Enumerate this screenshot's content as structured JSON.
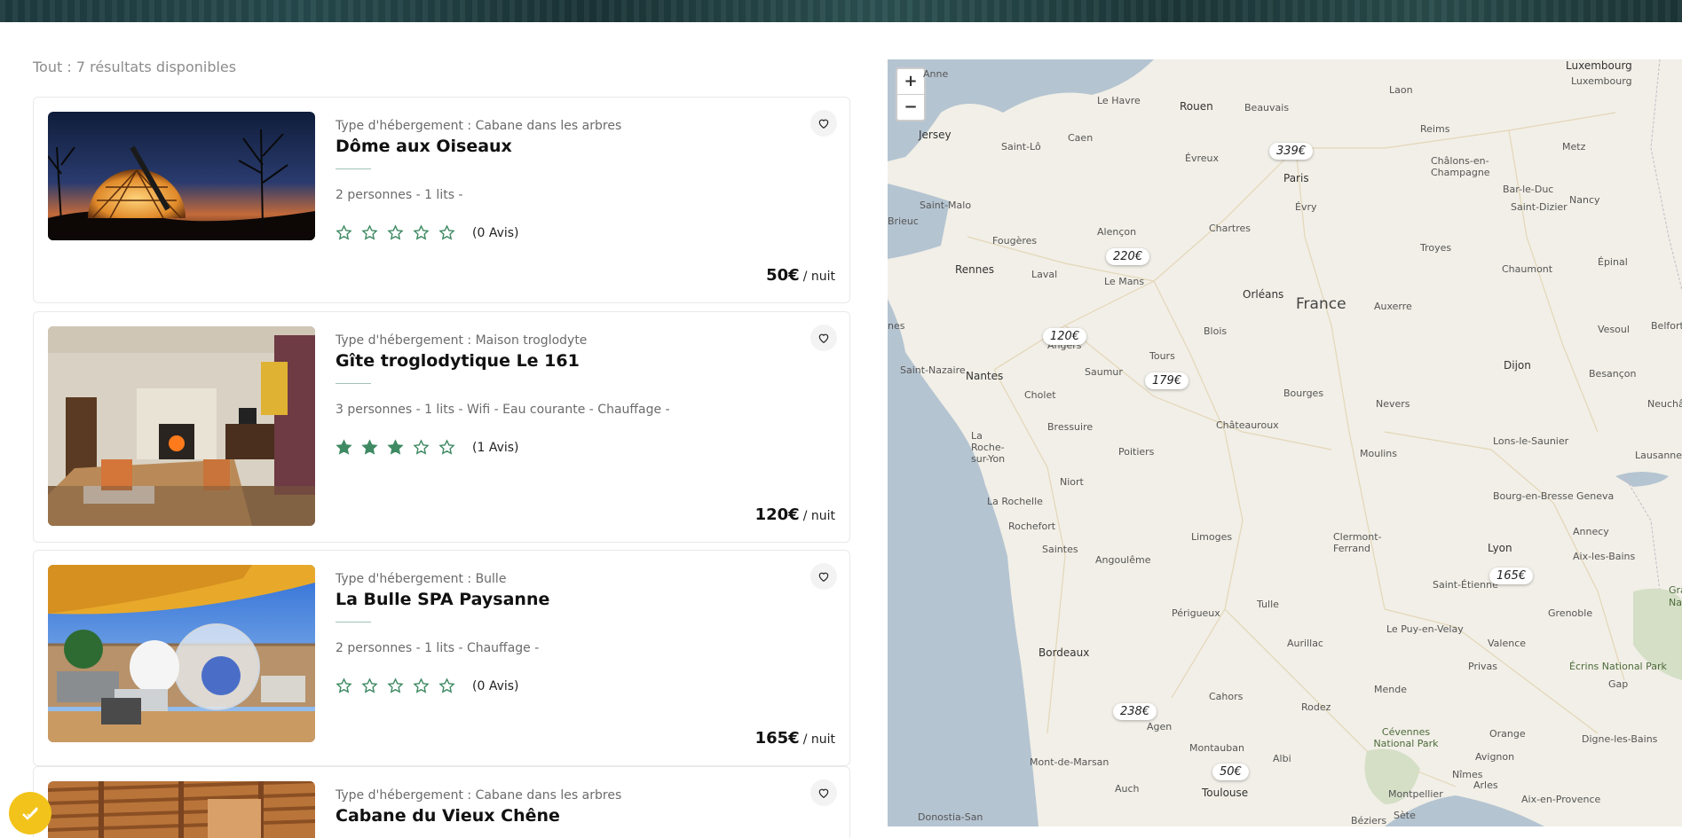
{
  "results": {
    "label": "Tout : 7 résultats disponibles"
  },
  "listings": [
    {
      "type": "Type d'hébergement : Cabane dans les arbres",
      "title": "Dôme aux Oiseaux",
      "features": "2 personnes - 1 lits -",
      "rating": 0,
      "reviews": "(0 Avis)",
      "price": "50€",
      "per_night": "/ nuit"
    },
    {
      "type": "Type d'hébergement : Maison troglodyte",
      "title": "Gîte troglodytique Le 161",
      "features": "3 personnes - 1 lits - Wifi - Eau courante - Chauffage -",
      "rating": 3,
      "reviews": "(1 Avis)",
      "price": "120€",
      "per_night": "/ nuit"
    },
    {
      "type": "Type d'hébergement : Bulle",
      "title": "La Bulle SPA Paysanne",
      "features": "2 personnes - 1 lits - Chauffage -",
      "rating": 0,
      "reviews": "(0 Avis)",
      "price": "165€",
      "per_night": "/ nuit"
    },
    {
      "type": "Type d'hébergement : Cabane dans les arbres",
      "title": "Cabane du Vieux Chêne"
    }
  ],
  "map": {
    "zoom_in": "+",
    "zoom_out": "−",
    "price_pins": [
      "339€",
      "220€",
      "120€",
      "179€",
      "165€",
      "238€",
      "50€"
    ],
    "labels": {
      "luxembourg": "Luxembourg",
      "luxembourg2": "Luxembourg",
      "anne": "Anne",
      "le_havre": "Le Havre",
      "rouen": "Rouen",
      "beauvais": "Beauvais",
      "laon": "Laon",
      "jersey": "Jersey",
      "saint_lo": "Saint-Lô",
      "caen": "Caen",
      "evreux": "Évreux",
      "reims": "Reims",
      "metz": "Metz",
      "paris": "Paris",
      "chalons": "Châlons-en-Champagne",
      "evry": "Évry",
      "saint_malo": "Saint-Malo",
      "brieuc": "Brieuc",
      "fougeres": "Fougères",
      "alencon": "Alençon",
      "chartres": "Chartres",
      "bar_le_duc": "Bar-le-Duc",
      "nancy": "Nancy",
      "saint_dizier": "Saint-Dizier",
      "troyes": "Troyes",
      "epinal": "Épinal",
      "rennes": "Rennes",
      "laval": "Laval",
      "le_mans": "Le Mans",
      "orleans": "Orléans",
      "chaumont": "Chaumont",
      "france": "France",
      "auxerre": "Auxerre",
      "vesoul": "Vesoul",
      "belfort": "Belfort",
      "blois": "Blois",
      "nes": "nes",
      "angers": "Angers",
      "tours": "Tours",
      "saint_nazaire": "Saint-Nazaire",
      "nantes": "Nantes",
      "saumur": "Saumur",
      "dijon": "Dijon",
      "besancon": "Besançon",
      "cholet": "Cholet",
      "bourges": "Bourges",
      "nevers": "Nevers",
      "neuchat": "Neuchât",
      "bressuire": "Bressuire",
      "chateauroux": "Châteauroux",
      "la_roche": "La Roche-sur-Yon",
      "lons": "Lons-le-Saunier",
      "poitiers": "Poitiers",
      "moulins": "Moulins",
      "lausanne": "Lausanne",
      "niort": "Niort",
      "bourg": "Bourg-en-Bresse",
      "geneva": "Geneva",
      "la_rochelle": "La Rochelle",
      "rochefort": "Rochefort",
      "limoges": "Limoges",
      "clermont": "Clermont-Ferrand",
      "annecy": "Annecy",
      "saintes": "Saintes",
      "angouleme": "Angoulême",
      "lyon": "Lyon",
      "aix_les_bains": "Aix-les-Bains",
      "saint_etienne": "Saint-Étienne",
      "gran": "Gra",
      "nat": "Nat",
      "perigueux": "Périgueux",
      "tulle": "Tulle",
      "grenoble": "Grenoble",
      "le_puy": "Le Puy-en-Velay",
      "bordeaux": "Bordeaux",
      "aurillac": "Aurillac",
      "valence": "Valence",
      "ecrins": "Écrins National Park",
      "privas": "Privas",
      "gap": "Gap",
      "mende": "Mende",
      "cahors": "Cahors",
      "rodez": "Rodez",
      "agen": "Agen",
      "cevennes": "Cévennes National Park",
      "orange": "Orange",
      "digne": "Digne-les-Bains",
      "montauban": "Montauban",
      "albi": "Albi",
      "mont_de_marsan": "Mont-de-Marsan",
      "avignon": "Avignon",
      "nimes": "Nîmes",
      "auch": "Auch",
      "toulouse": "Toulouse",
      "montpellier": "Montpellier",
      "arles": "Arles",
      "aix_en_provence": "Aix-en-Provence",
      "donostia": "Donostia-San",
      "beziers": "Béziers",
      "sete": "Sète"
    }
  },
  "colors": {
    "accent": "#3f8a63",
    "price_pin_bg": "#ffffff",
    "map_land": "#f1efe7",
    "map_water": "#b5c4d1"
  }
}
